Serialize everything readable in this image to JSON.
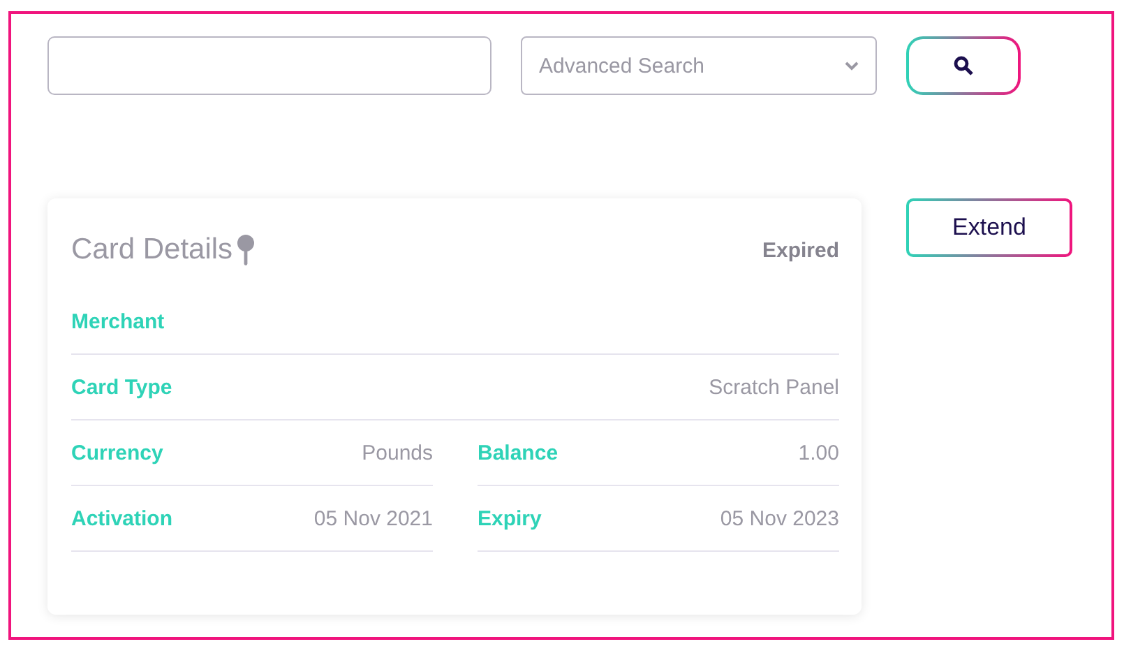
{
  "search": {
    "advanced_search": {
      "placeholder": "Advanced Search"
    }
  },
  "actions": {
    "extend_button": "Extend"
  },
  "card": {
    "title": "Card Details",
    "status": "Expired",
    "rows": [
      {
        "kind": "full",
        "fields": [
          {
            "label": "Merchant"
          }
        ]
      },
      {
        "kind": "full",
        "fields": [
          {
            "label": "Card Type",
            "value": "Scratch Panel"
          }
        ]
      },
      {
        "kind": "split",
        "fields": [
          {
            "label": "Currency",
            "value": "Pounds"
          },
          {
            "label": "Balance",
            "value": "1.00"
          }
        ]
      },
      {
        "kind": "split",
        "fields": [
          {
            "label": "Activation",
            "value": "05 Nov 2021"
          },
          {
            "label": "Expiry",
            "value": "05 Nov 2023"
          }
        ]
      }
    ]
  }
}
